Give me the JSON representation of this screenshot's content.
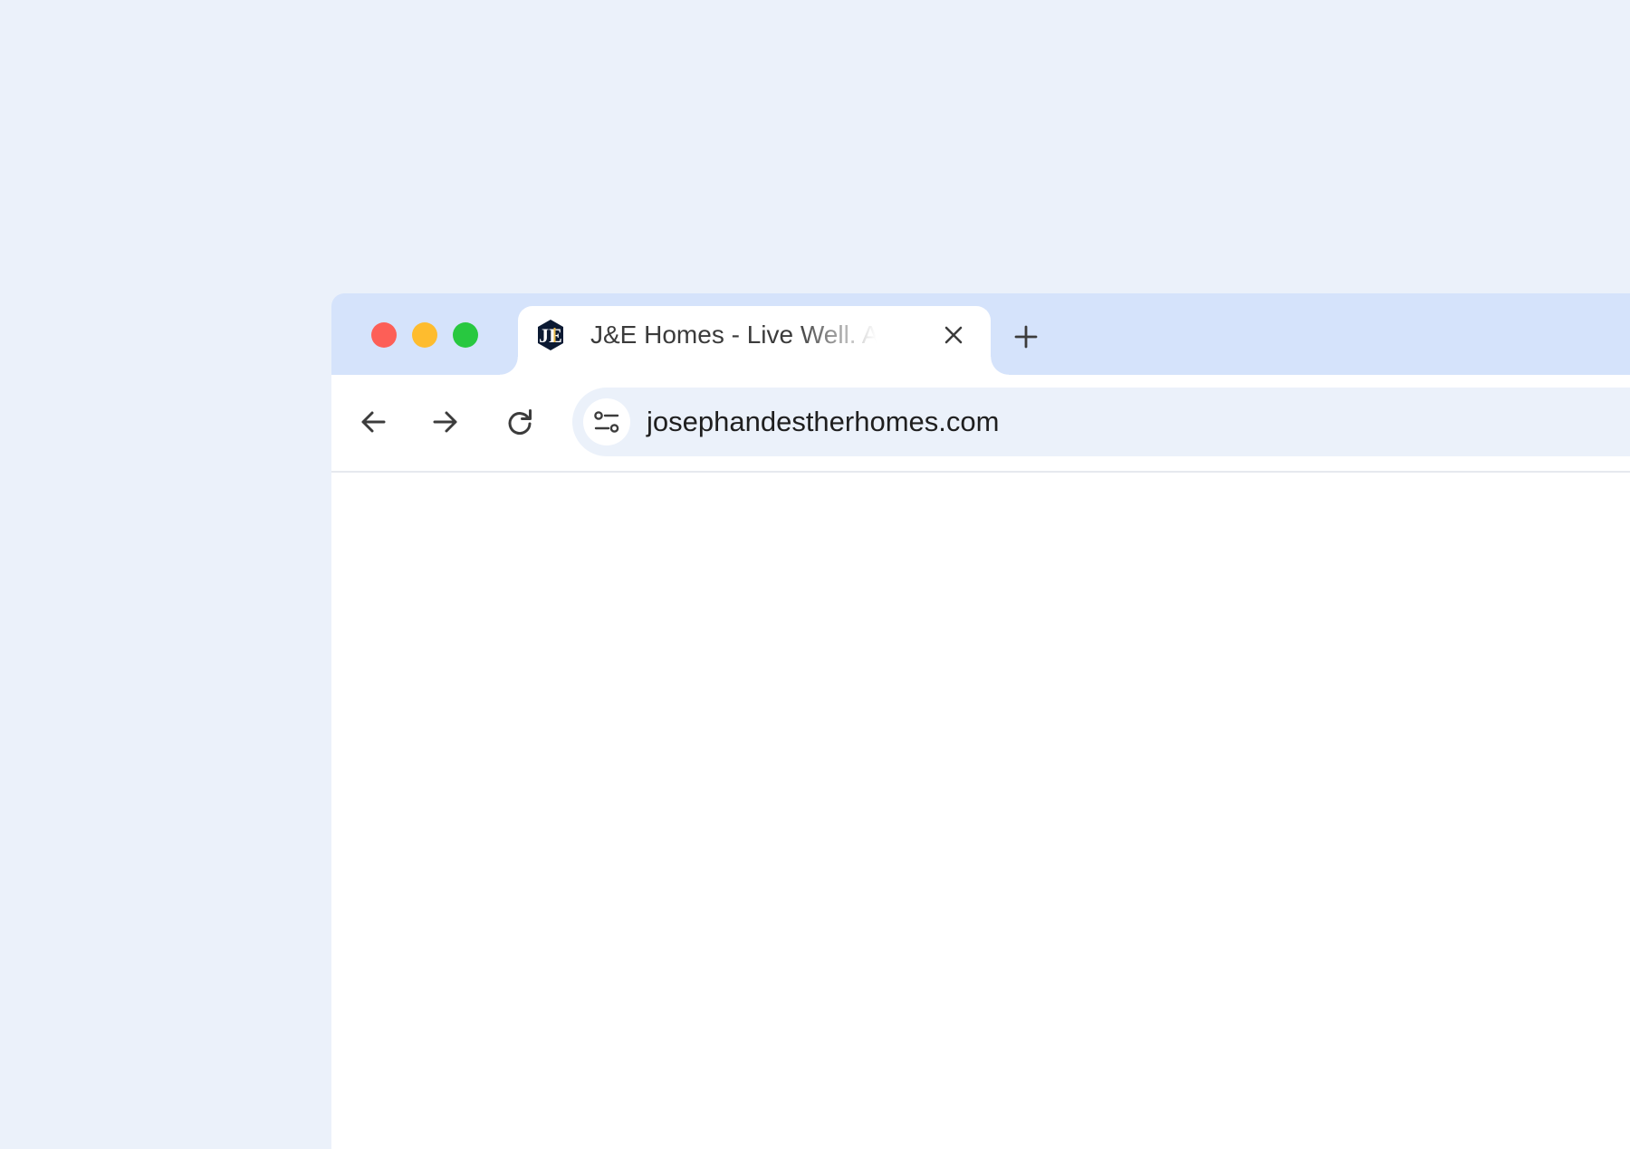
{
  "window": {
    "controls": [
      "close",
      "minimize",
      "zoom"
    ],
    "colors": {
      "close": "#fd5f57",
      "minimize": "#febc2e",
      "zoom": "#28c840",
      "tabstrip": "#d5e3fb",
      "omnibox": "#ebf1fa",
      "background": "#ebf1fa"
    }
  },
  "tab": {
    "title": "J&E Homes - Live Well. Ag",
    "favicon_icon": "je-homes-logo-icon",
    "close_icon": "close-icon"
  },
  "new_tab": {
    "icon": "plus-icon"
  },
  "toolbar": {
    "back_icon": "arrow-left-icon",
    "forward_icon": "arrow-right-icon",
    "reload_icon": "reload-icon"
  },
  "omnibox": {
    "site_info_icon": "tune-icon",
    "url": "josephandestherhomes.com"
  }
}
